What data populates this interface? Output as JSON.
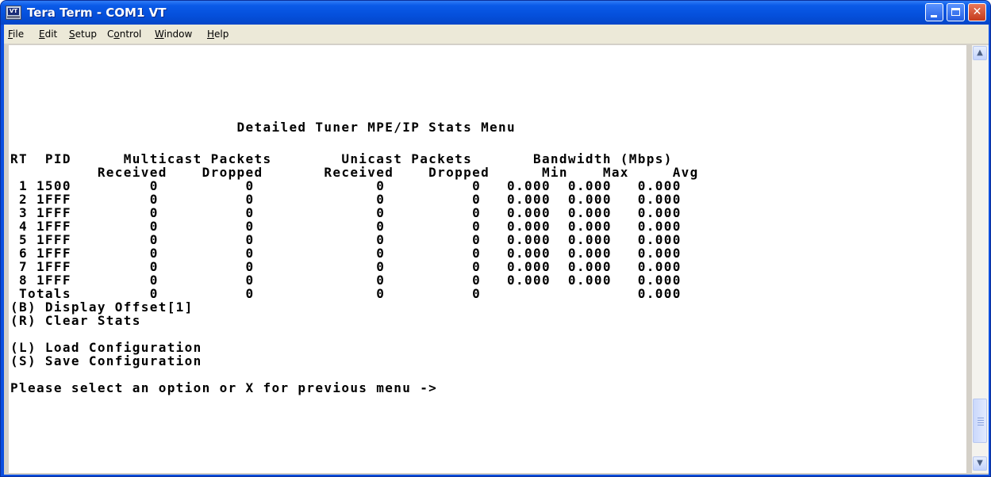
{
  "window": {
    "title": "Tera Term - COM1 VT",
    "icon_label": "VT",
    "icon_name": "teraterm-icon"
  },
  "title_buttons": {
    "minimize_icon": "minimize-icon",
    "maximize_icon": "maximize-icon",
    "close_glyph": "✕"
  },
  "menu": {
    "items": [
      {
        "pre": "",
        "acc": "F",
        "post": "ile"
      },
      {
        "pre": "",
        "acc": "E",
        "post": "dit"
      },
      {
        "pre": "",
        "acc": "S",
        "post": "etup"
      },
      {
        "pre": "C",
        "acc": "o",
        "post": "ntrol"
      },
      {
        "pre": "",
        "acc": "W",
        "post": "indow"
      },
      {
        "pre": "",
        "acc": "H",
        "post": "elp"
      }
    ]
  },
  "terminal": {
    "lines": [
      "                          Detailed Tuner MPE/IP Stats Menu",
      "RT  PID      Multicast Packets        Unicast Packets       Bandwidth (Mbps)",
      "          Received    Dropped       Received    Dropped      Min    Max     Avg",
      " 1 1500         0          0              0          0   0.000  0.000   0.000",
      " 2 1FFF         0          0              0          0   0.000  0.000   0.000",
      " 3 1FFF         0          0              0          0   0.000  0.000   0.000",
      " 4 1FFF         0          0              0          0   0.000  0.000   0.000",
      " 5 1FFF         0          0              0          0   0.000  0.000   0.000",
      " 6 1FFF         0          0              0          0   0.000  0.000   0.000",
      " 7 1FFF         0          0              0          0   0.000  0.000   0.000",
      " 8 1FFF         0          0              0          0   0.000  0.000   0.000",
      " Totals         0          0              0          0                  0.000",
      "(B) Display Offset[1]",
      "(R) Clear Stats",
      "",
      "(L) Load Configuration",
      "(S) Save Configuration",
      "",
      "Please select an option or X for previous menu ->"
    ]
  },
  "scrollbar": {
    "up_glyph": "▲",
    "down_glyph": "▼"
  },
  "colors": {
    "titlebar": "#0a5ae8",
    "menubar": "#ece9d8",
    "terminal_bg": "#ffffff",
    "terminal_fg": "#000000"
  }
}
